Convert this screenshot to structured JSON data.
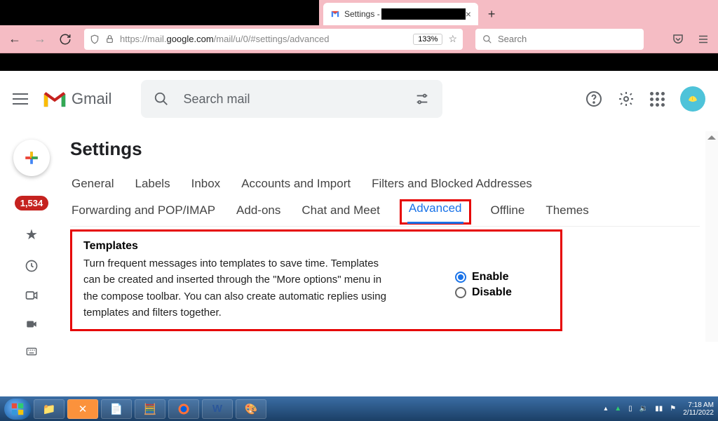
{
  "browser": {
    "tab_title": "Settings -",
    "url_prefix": "https://mail.",
    "url_domain": "google.com",
    "url_suffix": "/mail/u/0/#settings/advanced",
    "zoom": "133%",
    "search_placeholder": "Search",
    "newtab_glyph": "+",
    "close_glyph": "×"
  },
  "gmail": {
    "brand": "Gmail",
    "search_placeholder": "Search mail"
  },
  "leftrail": {
    "badge_count": "1,534"
  },
  "settings": {
    "title": "Settings",
    "tabs_row1": [
      "General",
      "Labels",
      "Inbox",
      "Accounts and Import",
      "Filters and Blocked Addresses"
    ],
    "tabs_row2": [
      "Forwarding and POP/IMAP",
      "Add-ons",
      "Chat and Meet",
      "Advanced",
      "Offline",
      "Themes"
    ],
    "active_tab": "Advanced",
    "templates": {
      "heading": "Templates",
      "desc": "Turn frequent messages into templates to save time. Templates can be created and inserted through the \"More options\" menu in the compose toolbar. You can also create automatic replies using templates and filters together.",
      "enable": "Enable",
      "disable": "Disable",
      "selected": "enable"
    }
  },
  "taskbar": {
    "time": "7:18 AM",
    "date": "2/11/2022"
  }
}
